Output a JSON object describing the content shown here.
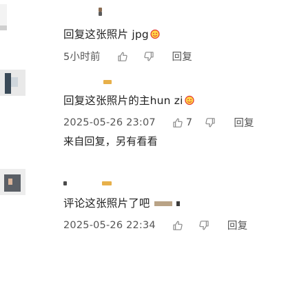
{
  "comments": [
    {
      "text": "回复这张照片 jpg",
      "time": "5小时前",
      "likes": "",
      "reply_label": "回复"
    },
    {
      "text": "回复这张照片的主hun zi",
      "time": "2025-05-26 23:07",
      "likes": "7",
      "reply_label": "回复",
      "extra": "来自回复，另有看看"
    },
    {
      "text": "评论这张照片了吧",
      "time": "2025-05-26 22:34",
      "likes": "",
      "reply_label": "回复"
    }
  ],
  "colors": {
    "text": "#222222",
    "meta": "#555555",
    "accent": "#e2332f"
  }
}
